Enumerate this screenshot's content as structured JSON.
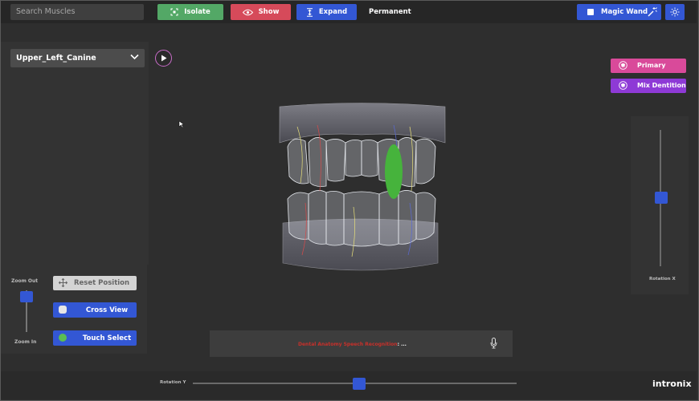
{
  "toolbar": {
    "search_placeholder": "Search Muscles",
    "isolate_label": "Isolate",
    "show_label": "Show",
    "expand_label": "Expand",
    "mode_label": "Permanent",
    "magic_wand_label": "Magic Wand"
  },
  "left_panel": {
    "selected_muscle": "Upper_Left_Canine"
  },
  "right_panel": {
    "primary_label": "Primary",
    "mix_dentition_label": "Mix Dentition",
    "rotation_x_label": "Rotation X",
    "rotation_x_value": 0.5
  },
  "zoom": {
    "zoom_out_label": "Zoom Out",
    "zoom_in_label": "Zoom In",
    "zoom_value": 0.95
  },
  "actions": {
    "reset_label": "Reset Position",
    "cross_view_label": "Cross View",
    "touch_select_label": "Touch Select"
  },
  "status": {
    "message": "Dental Anatomy Speech Recognition",
    "ellipsis": ": ..."
  },
  "bottom": {
    "rotation_y_label": "Rotation Y",
    "rotation_y_value": 0.5,
    "brand": "intronix"
  },
  "colors": {
    "isolate": "#53a866",
    "show": "#d64a5a",
    "blue_accent": "#3357d4",
    "primary": "#d94a9a",
    "mix_dentition": "#8e3ad6",
    "highlight_tooth": "#46b33c"
  },
  "icons": {
    "isolate": "isolate-icon",
    "show": "eye-icon",
    "expand": "expand-icon",
    "magic_wand": "magic-wand-icon",
    "settings": "sun-icon",
    "play": "play-icon",
    "dropdown": "chevron-down-icon",
    "primary": "tooth-icon",
    "mix_dentition": "tooth-icon",
    "reset": "move-icon",
    "mic": "microphone-icon"
  }
}
